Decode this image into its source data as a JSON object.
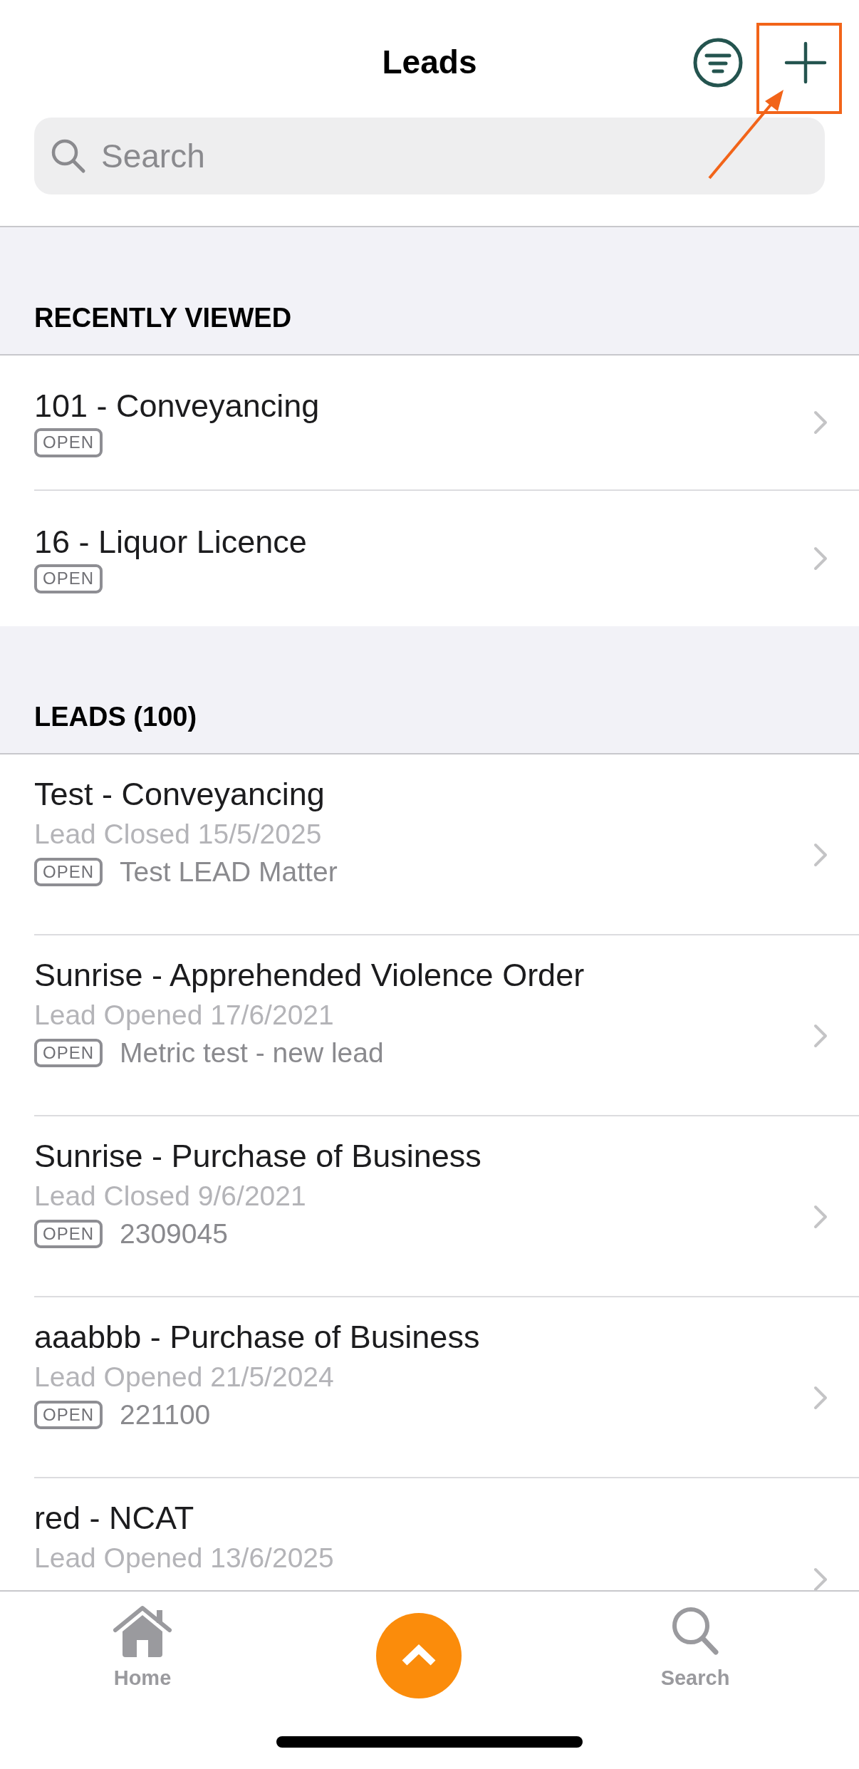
{
  "header": {
    "title": "Leads"
  },
  "search": {
    "placeholder": "Search"
  },
  "sections": [
    {
      "title": "RECENTLY VIEWED",
      "kind": "recent",
      "items": [
        {
          "title": "101 - Conveyancing",
          "badge": "OPEN"
        },
        {
          "title": "16 - Liquor Licence",
          "badge": "OPEN"
        }
      ]
    },
    {
      "title": "LEADS (100)",
      "kind": "leads",
      "items": [
        {
          "title": "Test - Conveyancing",
          "status": "Lead Closed 15/5/2025",
          "badge": "OPEN",
          "matter": "Test LEAD Matter"
        },
        {
          "title": "Sunrise - Apprehended Violence Order",
          "status": "Lead Opened 17/6/2021",
          "badge": "OPEN",
          "matter": "Metric test - new lead"
        },
        {
          "title": "Sunrise - Purchase of Business",
          "status": "Lead Closed 9/6/2021",
          "badge": "OPEN",
          "matter": "2309045"
        },
        {
          "title": "aaabbb - Purchase of Business",
          "status": "Lead Opened 21/5/2024",
          "badge": "OPEN",
          "matter": "221100"
        },
        {
          "title": "red - NCAT",
          "status": "Lead Opened 13/6/2025"
        }
      ]
    }
  ],
  "tab_bar": {
    "items": [
      {
        "kind": "home",
        "label": "Home"
      },
      {
        "kind": "up"
      },
      {
        "kind": "search",
        "label": "Search"
      }
    ]
  }
}
